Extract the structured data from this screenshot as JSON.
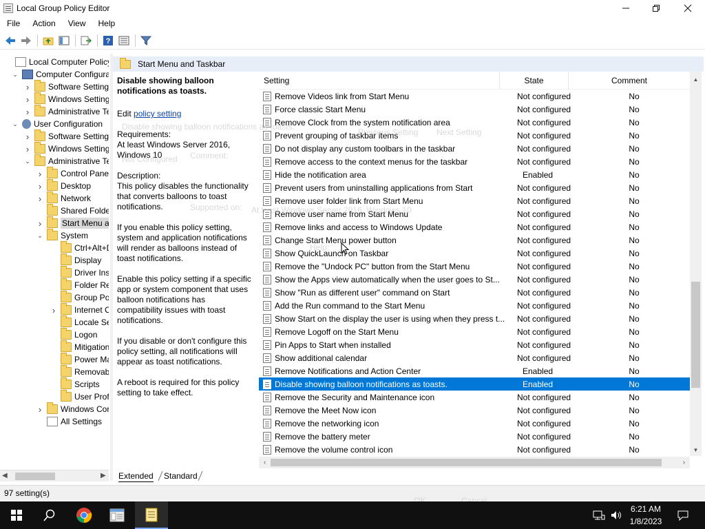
{
  "window": {
    "title": "Local Group Policy Editor"
  },
  "menu": [
    "File",
    "Action",
    "View",
    "Help"
  ],
  "tree": [
    {
      "label": "Local Computer Policy",
      "level": 0,
      "exp": "",
      "icon": "policy"
    },
    {
      "label": "Computer Configura",
      "level": 1,
      "exp": "v",
      "icon": "pc"
    },
    {
      "label": "Software Settings",
      "level": 2,
      "exp": ">",
      "icon": "folder"
    },
    {
      "label": "Windows Setting",
      "level": 2,
      "exp": ">",
      "icon": "folder"
    },
    {
      "label": "Administrative Te",
      "level": 2,
      "exp": ">",
      "icon": "folder"
    },
    {
      "label": "User Configuration",
      "level": 1,
      "exp": "v",
      "icon": "user"
    },
    {
      "label": "Software Settings",
      "level": 2,
      "exp": ">",
      "icon": "folder"
    },
    {
      "label": "Windows Setting",
      "level": 2,
      "exp": ">",
      "icon": "folder"
    },
    {
      "label": "Administrative Te",
      "level": 2,
      "exp": "v",
      "icon": "folder"
    },
    {
      "label": "Control Panel",
      "level": 3,
      "exp": ">",
      "icon": "folder"
    },
    {
      "label": "Desktop",
      "level": 3,
      "exp": ">",
      "icon": "folder"
    },
    {
      "label": "Network",
      "level": 3,
      "exp": ">",
      "icon": "folder"
    },
    {
      "label": "Shared Folder",
      "level": 3,
      "exp": "",
      "icon": "folder"
    },
    {
      "label": "Start Menu ar",
      "level": 3,
      "exp": ">",
      "icon": "folder",
      "selected": true
    },
    {
      "label": "System",
      "level": 3,
      "exp": "v",
      "icon": "folder"
    },
    {
      "label": "Ctrl+Alt+D",
      "level": 4,
      "exp": "",
      "icon": "folder"
    },
    {
      "label": "Display",
      "level": 4,
      "exp": "",
      "icon": "folder"
    },
    {
      "label": "Driver Inst",
      "level": 4,
      "exp": "",
      "icon": "folder"
    },
    {
      "label": "Folder Red",
      "level": 4,
      "exp": "",
      "icon": "folder"
    },
    {
      "label": "Group Pol",
      "level": 4,
      "exp": "",
      "icon": "folder"
    },
    {
      "label": "Internet C",
      "level": 4,
      "exp": ">",
      "icon": "folder"
    },
    {
      "label": "Locale Ser",
      "level": 4,
      "exp": "",
      "icon": "folder"
    },
    {
      "label": "Logon",
      "level": 4,
      "exp": "",
      "icon": "folder"
    },
    {
      "label": "Mitigation",
      "level": 4,
      "exp": "",
      "icon": "folder"
    },
    {
      "label": "Power Ma",
      "level": 4,
      "exp": "",
      "icon": "folder"
    },
    {
      "label": "Removabl",
      "level": 4,
      "exp": "",
      "icon": "folder"
    },
    {
      "label": "Scripts",
      "level": 4,
      "exp": "",
      "icon": "folder"
    },
    {
      "label": "User Profi",
      "level": 4,
      "exp": "",
      "icon": "folder"
    },
    {
      "label": "Windows Cor",
      "level": 3,
      "exp": ">",
      "icon": "folder"
    },
    {
      "label": "All Settings",
      "level": 3,
      "exp": "",
      "icon": "policy"
    }
  ],
  "right_header": "Start Menu and Taskbar",
  "description": {
    "title": "Disable showing balloon notifications as toasts.",
    "edit_prefix": "Edit",
    "edit_link": "policy setting",
    "requirements_label": "Requirements:",
    "requirements": "At least Windows Server 2016, Windows 10",
    "description_label": "Description:",
    "p1": "This policy disables the functionality that converts balloons to toast notifications.",
    "p2": "If you enable this policy setting, system and application notifications will render as balloons instead of toast notifications.",
    "p3": "Enable this policy setting if a specific app or system component that uses balloon notifications has compatibility issues with toast notifications.",
    "p4": "If you disable or don't configure this policy setting, all notifications will appear as toast notifications.",
    "p5": "A reboot is required for this policy setting to take effect."
  },
  "columns": {
    "setting": "Setting",
    "state": "State",
    "comment": "Comment"
  },
  "settings": [
    {
      "name": "Remove Videos link from Start Menu",
      "state": "Not configured",
      "comment": "No"
    },
    {
      "name": "Force classic Start Menu",
      "state": "Not configured",
      "comment": "No"
    },
    {
      "name": "Remove Clock from the system notification area",
      "state": "Not configured",
      "comment": "No"
    },
    {
      "name": "Prevent grouping of taskbar items",
      "state": "Not configured",
      "comment": "No"
    },
    {
      "name": "Do not display any custom toolbars in the taskbar",
      "state": "Not configured",
      "comment": "No"
    },
    {
      "name": "Remove access to the context menus for the taskbar",
      "state": "Not configured",
      "comment": "No"
    },
    {
      "name": "Hide the notification area",
      "state": "Enabled",
      "comment": "No"
    },
    {
      "name": "Prevent users from uninstalling applications from Start",
      "state": "Not configured",
      "comment": "No"
    },
    {
      "name": "Remove user folder link from Start Menu",
      "state": "Not configured",
      "comment": "No"
    },
    {
      "name": "Remove user name from Start Menu",
      "state": "Not configured",
      "comment": "No"
    },
    {
      "name": "Remove links and access to Windows Update",
      "state": "Not configured",
      "comment": "No"
    },
    {
      "name": "Change Start Menu power button",
      "state": "Not configured",
      "comment": "No"
    },
    {
      "name": "Show QuickLaunch on Taskbar",
      "state": "Not configured",
      "comment": "No"
    },
    {
      "name": "Remove the \"Undock PC\" button from the Start Menu",
      "state": "Not configured",
      "comment": "No"
    },
    {
      "name": "Show the Apps view automatically when the user goes to St...",
      "state": "Not configured",
      "comment": "No"
    },
    {
      "name": "Show \"Run as different user\" command on Start",
      "state": "Not configured",
      "comment": "No"
    },
    {
      "name": "Add the Run command to the Start Menu",
      "state": "Not configured",
      "comment": "No"
    },
    {
      "name": "Show Start on the display the user is using when they press t...",
      "state": "Not configured",
      "comment": "No"
    },
    {
      "name": "Remove Logoff on the Start Menu",
      "state": "Not configured",
      "comment": "No"
    },
    {
      "name": "Pin Apps to Start when installed",
      "state": "Not configured",
      "comment": "No"
    },
    {
      "name": "Show additional calendar",
      "state": "Not configured",
      "comment": "No"
    },
    {
      "name": "Remove Notifications and Action Center",
      "state": "Enabled",
      "comment": "No"
    },
    {
      "name": "Disable showing balloon notifications as toasts.",
      "state": "Enabled",
      "comment": "No",
      "selected": true
    },
    {
      "name": "Remove the Security and Maintenance icon",
      "state": "Not configured",
      "comment": "No"
    },
    {
      "name": "Remove the Meet Now icon",
      "state": "Not configured",
      "comment": "No"
    },
    {
      "name": "Remove the networking icon",
      "state": "Not configured",
      "comment": "No"
    },
    {
      "name": "Remove the battery meter",
      "state": "Not configured",
      "comment": "No"
    },
    {
      "name": "Remove the volume control icon",
      "state": "Not configured",
      "comment": "No"
    }
  ],
  "tabs": {
    "extended": "Extended",
    "standard": "Standard"
  },
  "status": "97 setting(s)",
  "clock": {
    "time": "6:21 AM",
    "date": "1/8/2023"
  },
  "ghost_dialog": {
    "title": "Disable showing balloon notifications as toasts.",
    "previous": "Previous Setting",
    "next": "Next Setting",
    "not_configured": "Not Configured",
    "comment": "Comment:",
    "supported_on": "Supported on:",
    "supported": "At least Windows Server 2016, Windows 10",
    "help": "Help:",
    "ok": "OK",
    "cancel": "Cancel"
  }
}
